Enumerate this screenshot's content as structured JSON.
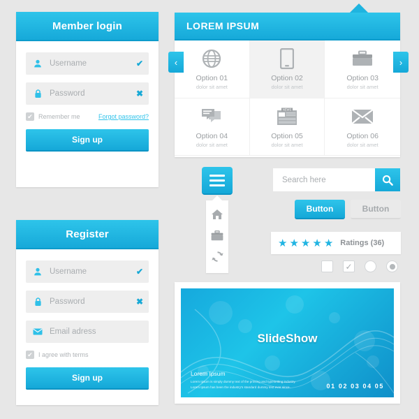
{
  "theme": {
    "accent": "#2ec4ea",
    "accent_dark": "#15a8d8",
    "page_bg": "#e7e7e7",
    "field_bg": "#eeeeee",
    "muted_text": "#a9adb0"
  },
  "login": {
    "title": "Member login",
    "fields": [
      {
        "icon": "user-icon",
        "placeholder": "Username",
        "value": "",
        "status": "valid",
        "status_glyph": "✔"
      },
      {
        "icon": "lock-icon",
        "placeholder": "Password",
        "value": "",
        "status": "invalid",
        "status_glyph": "✖"
      }
    ],
    "remember_label": "Remember me",
    "remember_checked": true,
    "forgot_label": "Forgot password?",
    "submit_label": "Sign up"
  },
  "register": {
    "title": "Register",
    "fields": [
      {
        "icon": "user-icon",
        "placeholder": "Username",
        "value": "",
        "status": "valid",
        "status_glyph": "✔"
      },
      {
        "icon": "lock-icon",
        "placeholder": "Password",
        "value": "",
        "status": "invalid",
        "status_glyph": "✖"
      },
      {
        "icon": "envelope-icon",
        "placeholder": "Email adress",
        "value": "",
        "status": "none",
        "status_glyph": ""
      }
    ],
    "terms_label": "I agree with terms",
    "terms_checked": true,
    "submit_label": "Sign up"
  },
  "options_panel": {
    "title": "LOREM IPSUM",
    "items": [
      {
        "icon": "globe-icon",
        "label": "Option 01",
        "sub": "dolor sit amet",
        "active": false
      },
      {
        "icon": "mobile-icon",
        "label": "Option 02",
        "sub": "dolor sit amet",
        "active": true
      },
      {
        "icon": "briefcase-icon",
        "label": "Option 03",
        "sub": "dolor sit amet",
        "active": false
      },
      {
        "icon": "chat-icon",
        "label": "Option 04",
        "sub": "dolor sit amet",
        "active": false
      },
      {
        "icon": "news-icon",
        "label": "Option 05",
        "sub": "dolor sit amet",
        "active": false
      },
      {
        "icon": "envelope-icon",
        "label": "Option 06",
        "sub": "dolor sit amet",
        "active": false
      }
    ]
  },
  "menu": {
    "toggle_icon": "hamburger-icon",
    "items": [
      {
        "icon": "home-icon"
      },
      {
        "icon": "briefcase-icon"
      },
      {
        "icon": "refresh-icon"
      }
    ]
  },
  "search": {
    "placeholder": "Search here",
    "value": "",
    "button_icon": "search-icon"
  },
  "buttons": {
    "primary_label": "Button",
    "secondary_label": "Button"
  },
  "ratings": {
    "stars": 5,
    "star_glyph": "★",
    "label": "Ratings (36)"
  },
  "toggles": [
    {
      "name": "checkbox-unchecked",
      "type": "checkbox",
      "checked": false
    },
    {
      "name": "checkbox-checked",
      "type": "checkbox",
      "checked": true,
      "glyph": "✔"
    },
    {
      "name": "radio-unselected",
      "type": "radio",
      "checked": false
    },
    {
      "name": "radio-selected",
      "type": "radio",
      "checked": true
    }
  ],
  "slideshow": {
    "title": "SlideShow",
    "caption_title": "Lorem Ipsum",
    "caption_line1": "Lorem Ipsum is simply dummy text of the printing and typesetting industry.",
    "caption_line2": "Lorem Ipsum has been the industry's standard dummy text ever since.",
    "pager": "01 02 03 04 05",
    "prev_glyph": "‹",
    "next_glyph": "›"
  }
}
